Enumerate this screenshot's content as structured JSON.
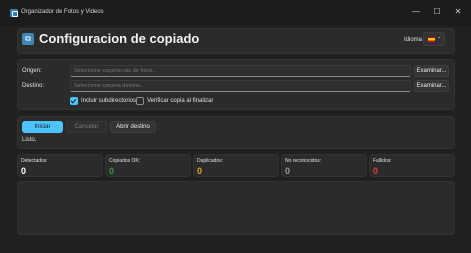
{
  "window": {
    "title": "Organizador de Fotos y Videos",
    "minimize": "—",
    "maximize": "☐",
    "close": "✕"
  },
  "header": {
    "title": "Configuracion de copiado",
    "icon": "copy-icon",
    "language_label": "Idioma",
    "language_flag": "spain-flag",
    "language_chevron": "⌄"
  },
  "paths": {
    "origin_label": "Origen:",
    "origin_placeholder": "Seleccione carpeta raiz de fotos...",
    "destination_label": "Destino:",
    "destination_placeholder": "Seleccione carpeta destino...",
    "browse_label": "Examinar..."
  },
  "options": {
    "include_subdirs": {
      "label": "Incluir subdirectorios",
      "checked": true
    },
    "verify_copy": {
      "label": "Verificar copia al finalizar",
      "checked": false
    }
  },
  "actions": {
    "start_label": "Iniciar",
    "cancel_label": "Cancelar",
    "open_dest_label": "Abrir destino",
    "status": "Listo."
  },
  "stats": [
    {
      "label": "Detectados:",
      "value": "0",
      "color": "#ffffff"
    },
    {
      "label": "Copiados OK:",
      "value": "0",
      "color": "#2e9b45"
    },
    {
      "label": "Duplicados:",
      "value": "0",
      "color": "#e8a317"
    },
    {
      "label": "No reconocidos:",
      "value": "0",
      "color": "#9a9a9a"
    },
    {
      "label": "Fallidos:",
      "value": "0",
      "color": "#e03c3c"
    }
  ],
  "colors": {
    "accent": "#4cc2ff",
    "background": "#202020",
    "panel": "#2b2b2b"
  }
}
